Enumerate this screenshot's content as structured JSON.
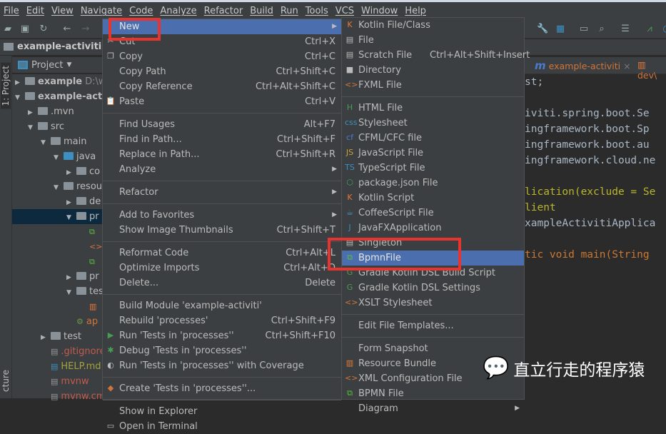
{
  "menubar": [
    "File",
    "Edit",
    "View",
    "Navigate",
    "Code",
    "Analyze",
    "Refactor",
    "Build",
    "Run",
    "Tools",
    "VCS",
    "Window",
    "Help"
  ],
  "navbar": {
    "project": "example-activiti"
  },
  "sidebar": {
    "tool_window": "1: Project",
    "structure": "cture",
    "panel_title": "Project"
  },
  "tree": [
    {
      "label": "example",
      "suffix": "D:\\wo",
      "bold": true,
      "depth": 0,
      "arrow": "▶"
    },
    {
      "label": "example-activ",
      "bold": true,
      "depth": 0,
      "arrow": "▼"
    },
    {
      "label": ".mvn",
      "depth": 1,
      "arrow": "▶"
    },
    {
      "label": "src",
      "depth": 1,
      "arrow": "▼"
    },
    {
      "label": "main",
      "depth": 2,
      "arrow": "▼"
    },
    {
      "label": "java",
      "depth": 3,
      "arrow": "▼",
      "color": "#3d8fc1"
    },
    {
      "label": "co",
      "depth": 4,
      "arrow": "▶"
    },
    {
      "label": "resou",
      "depth": 3,
      "arrow": "▼"
    },
    {
      "label": "de",
      "depth": 4,
      "arrow": "▶"
    },
    {
      "label": "pr",
      "depth": 4,
      "arrow": "▼",
      "selected": true
    },
    {
      "label": "",
      "depth": 5,
      "icon": "bpmn"
    },
    {
      "label": "",
      "depth": 5,
      "icon": "xml"
    },
    {
      "label": "",
      "depth": 5,
      "icon": "bpmn"
    },
    {
      "label": "pr",
      "depth": 4,
      "arrow": "▶"
    },
    {
      "label": "tes",
      "depth": 4,
      "arrow": "▼"
    },
    {
      "label": "",
      "depth": 5,
      "icon": "bundle"
    },
    {
      "label": "ap",
      "depth": 4,
      "icon": "spring",
      "textcolor": "#d0743a"
    },
    {
      "label": "test",
      "depth": 2,
      "arrow": "▶"
    },
    {
      "label": ".gitignore",
      "depth": 2,
      "icon": "file",
      "textcolor": "#c25b4e"
    },
    {
      "label": "HELP.md",
      "depth": 2,
      "icon": "md",
      "textcolor": "#a3a33a"
    },
    {
      "label": "mvnw",
      "depth": 2,
      "icon": "file",
      "textcolor": "#c25b4e"
    },
    {
      "label": "mvnw.cmd",
      "depth": 2,
      "icon": "file",
      "textcolor": "#c25b4e"
    }
  ],
  "editor": {
    "tabs": [
      {
        "label": "example-activiti",
        "close": "×"
      },
      {
        "label": "dev\\"
      }
    ],
    "code": [
      {
        "text": "st;"
      },
      {
        "text": ""
      },
      {
        "text": "iviti.spring.boot.Se"
      },
      {
        "text": "ingframework.boot.Sp"
      },
      {
        "text": "ingframework.boot.au"
      },
      {
        "text": "ingframework.cloud.ne"
      },
      {
        "text": ""
      },
      {
        "text": "lication(exclude = Se",
        "color": "#bbb529"
      },
      {
        "text": "lient",
        "color": "#bbb529"
      },
      {
        "text": "xampleActivitiApplica"
      },
      {
        "text": ""
      },
      {
        "text": "tic void main(String",
        "color": "#cc7832"
      }
    ]
  },
  "context_menu": [
    {
      "label": "New",
      "sub": true,
      "hl": true
    },
    {
      "label": "Cut",
      "sc": "Ctrl+X",
      "icon": "✂"
    },
    {
      "label": "Copy",
      "sc": "Ctrl+C",
      "icon": "❐"
    },
    {
      "label": "Copy Path",
      "sc": "Ctrl+Shift+C"
    },
    {
      "label": "Copy Reference",
      "sc": "Ctrl+Alt+Shift+C"
    },
    {
      "label": "Paste",
      "sc": "Ctrl+V",
      "icon": "📋"
    },
    {
      "sep": true
    },
    {
      "label": "Find Usages",
      "sc": "Alt+F7"
    },
    {
      "label": "Find in Path...",
      "sc": "Ctrl+Shift+F"
    },
    {
      "label": "Replace in Path...",
      "sc": "Ctrl+Shift+R"
    },
    {
      "label": "Analyze",
      "sub": true
    },
    {
      "sep": true
    },
    {
      "label": "Refactor",
      "sub": true
    },
    {
      "sep": true
    },
    {
      "label": "Add to Favorites",
      "sub": true
    },
    {
      "label": "Show Image Thumbnails",
      "sc": "Ctrl+Shift+T"
    },
    {
      "sep": true
    },
    {
      "label": "Reformat Code",
      "sc": "Ctrl+Alt+L"
    },
    {
      "label": "Optimize Imports",
      "sc": "Ctrl+Alt+O"
    },
    {
      "label": "Delete...",
      "sc": "Delete"
    },
    {
      "sep": true
    },
    {
      "label": "Build Module 'example-activiti'"
    },
    {
      "label": "Rebuild 'processes'",
      "sc": "Ctrl+Shift+F9"
    },
    {
      "label": "Run 'Tests in 'processes''",
      "sc": "Ctrl+Shift+F10",
      "icon": "▶",
      "iconColor": "#499c54"
    },
    {
      "label": "Debug 'Tests in 'processes''",
      "icon": "✱",
      "iconColor": "#499c54"
    },
    {
      "label": "Run 'Tests in 'processes'' with Coverage",
      "icon": "◐"
    },
    {
      "sep": true
    },
    {
      "label": "Create 'Tests in 'processes''...",
      "icon": "◆",
      "iconColor": "#d0743a"
    },
    {
      "sep": true
    },
    {
      "label": "Show in Explorer"
    },
    {
      "label": "Open in Terminal",
      "icon": "▭"
    }
  ],
  "new_submenu": [
    {
      "label": "Kotlin File/Class",
      "icon": "K",
      "iconColor": "#e8793a"
    },
    {
      "label": "File",
      "icon": "▤"
    },
    {
      "label": "Scratch File",
      "sc": "Ctrl+Alt+Shift+Insert",
      "icon": "▤"
    },
    {
      "label": "Directory",
      "icon": "■"
    },
    {
      "label": "FXML File",
      "icon": "<>",
      "iconColor": "#d0743a"
    },
    {
      "sep": true
    },
    {
      "label": "HTML File",
      "icon": "H",
      "iconColor": "#499c54"
    },
    {
      "label": "Stylesheet",
      "icon": "css",
      "iconColor": "#3d8fc1"
    },
    {
      "label": "CFML/CFC file",
      "icon": "cf",
      "iconColor": "#4a7bd0"
    },
    {
      "label": "JavaScript File",
      "icon": "JS",
      "iconColor": "#c9a03a"
    },
    {
      "label": "TypeScript File",
      "icon": "TS",
      "iconColor": "#3d8fc1"
    },
    {
      "label": "package.json File",
      "icon": "⬡",
      "iconColor": "#499c54"
    },
    {
      "label": "Kotlin Script",
      "icon": "K",
      "iconColor": "#e8793a"
    },
    {
      "label": "CoffeeScript File",
      "icon": "☕",
      "iconColor": "#3d8fc1"
    },
    {
      "label": "JavaFXApplication",
      "icon": "J",
      "iconColor": "#3d8fc1"
    },
    {
      "label": "Singleton",
      "icon": "▤"
    },
    {
      "label": "BpmnFile",
      "icon": "⧉",
      "iconColor": "#59c23a",
      "hl": true
    },
    {
      "label": "Gradle Kotlin DSL Build Script",
      "icon": "G",
      "iconColor": "#499c54"
    },
    {
      "label": "Gradle Kotlin DSL Settings",
      "icon": "G",
      "iconColor": "#499c54"
    },
    {
      "label": "XSLT Stylesheet",
      "icon": "<>",
      "iconColor": "#d0743a"
    },
    {
      "sep": true
    },
    {
      "label": "Edit File Templates..."
    },
    {
      "sep": true
    },
    {
      "label": "Form Snapshot"
    },
    {
      "label": "Resource Bundle",
      "icon": "▥",
      "iconColor": "#e8793a"
    },
    {
      "label": "XML Configuration File",
      "icon": "<>",
      "iconColor": "#d0743a"
    },
    {
      "label": "BPMN File",
      "icon": "⧉",
      "iconColor": "#59c23a"
    },
    {
      "label": "Diagram",
      "sub": true
    }
  ],
  "watermark": "直立行走的程序猿",
  "colors": {
    "highlight": "#4b6eaf",
    "annotation": "#e8342f"
  }
}
